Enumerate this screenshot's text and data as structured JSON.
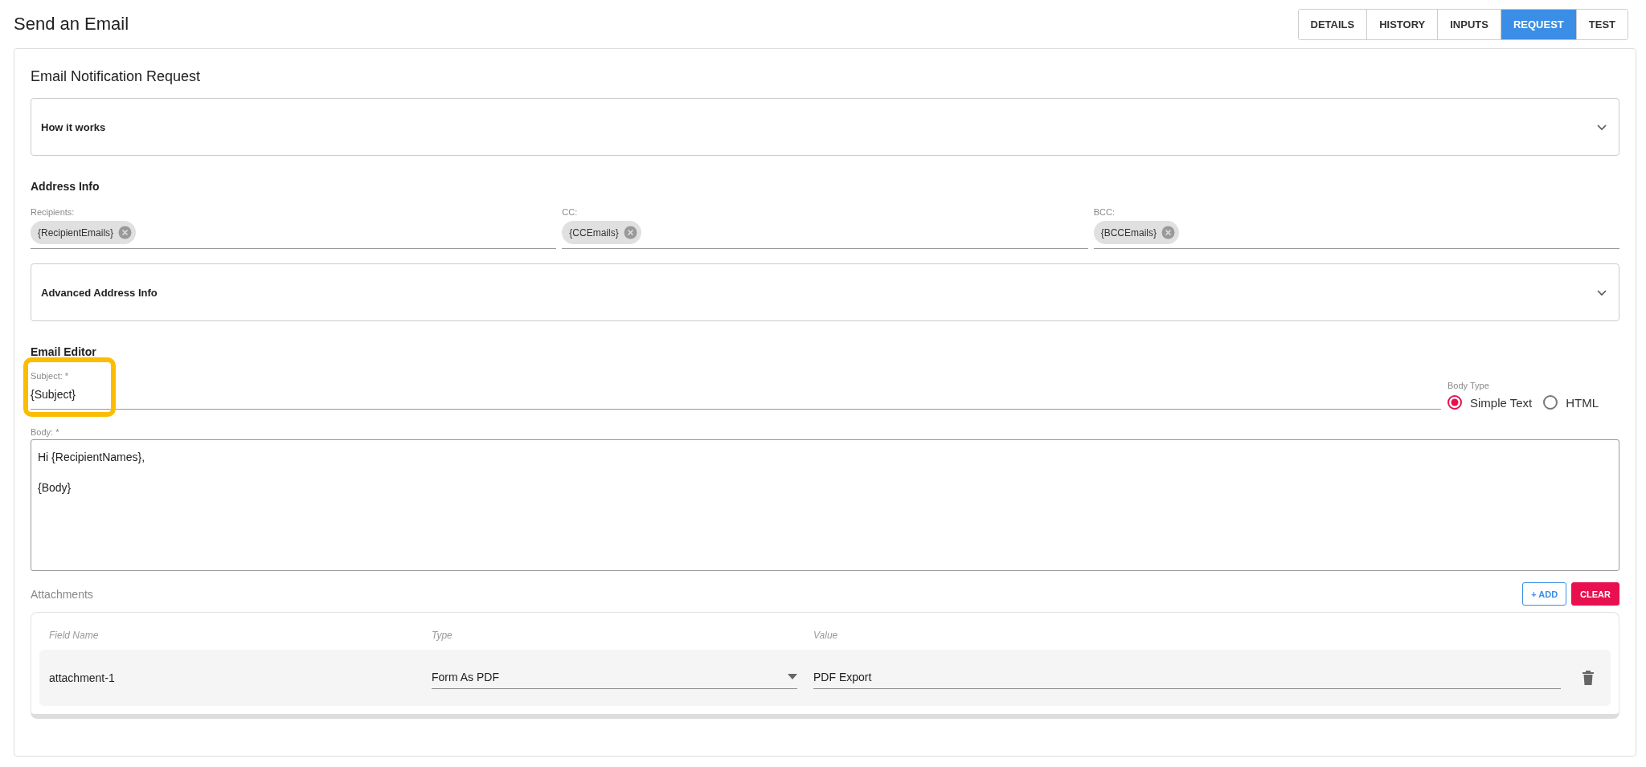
{
  "page_title": "Send an Email",
  "tabs": [
    {
      "label": "DETAILS",
      "selected": false
    },
    {
      "label": "HISTORY",
      "selected": false
    },
    {
      "label": "INPUTS",
      "selected": false
    },
    {
      "label": "REQUEST",
      "selected": true
    },
    {
      "label": "TEST",
      "selected": false
    }
  ],
  "card": {
    "title": "Email Notification Request",
    "how_it_works": {
      "title": "How it works",
      "expanded": false
    },
    "address_info": {
      "heading": "Address Info",
      "fields": [
        {
          "label": "Recipients:",
          "chips": [
            "{RecipientEmails}"
          ]
        },
        {
          "label": "CC:",
          "chips": [
            "{CCEmails}"
          ]
        },
        {
          "label": "BCC:",
          "chips": [
            "{BCCEmails}"
          ]
        }
      ]
    },
    "advanced_address_info": {
      "title": "Advanced Address Info",
      "expanded": false
    },
    "email_editor": {
      "heading": "Email Editor",
      "subject": {
        "label": "Subject: *",
        "value": "{Subject}",
        "highlighted": true
      },
      "body_type": {
        "label": "Body Type",
        "options": [
          {
            "label": "Simple Text",
            "selected": true
          },
          {
            "label": "HTML",
            "selected": false
          }
        ]
      },
      "body": {
        "label": "Body: *",
        "lines": [
          "Hi {RecipientNames},",
          "{Body}"
        ]
      }
    },
    "attachments": {
      "heading": "Attachments",
      "buttons": [
        {
          "label": "+ ADD",
          "kind": "outline"
        },
        {
          "label": "CLEAR",
          "kind": "filled"
        }
      ],
      "columns": [
        "Field Name",
        "Type",
        "Value"
      ],
      "rows": [
        {
          "field_name": "attachment-1",
          "type": "Form As PDF",
          "value": "PDF Export"
        }
      ]
    }
  }
}
